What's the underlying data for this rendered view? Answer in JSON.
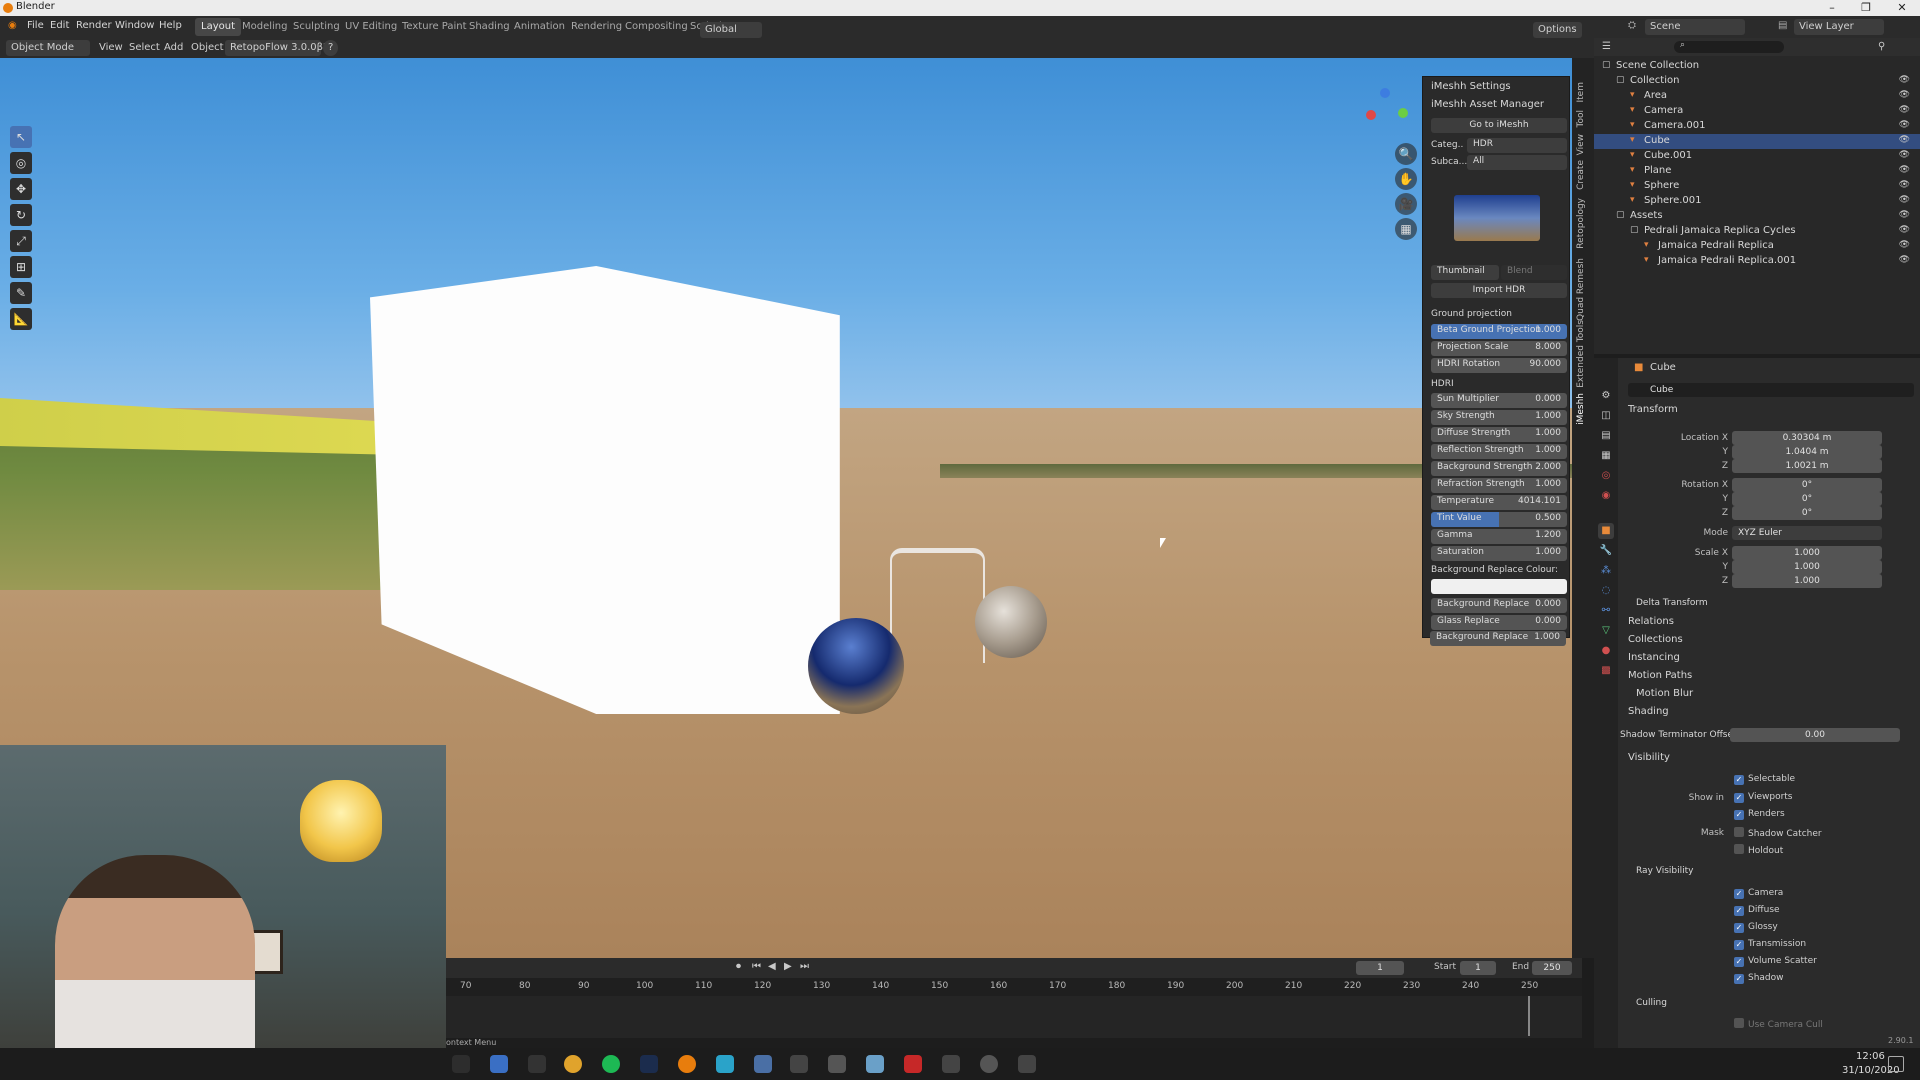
{
  "window": {
    "title": "Blender",
    "min": "–",
    "max": "❐",
    "close": "✕"
  },
  "menu": [
    "File",
    "Edit",
    "Render",
    "Window",
    "Help"
  ],
  "workspaces": [
    "Layout",
    "Modeling",
    "Sculpting",
    "UV Editing",
    "Texture Paint",
    "Shading",
    "Animation",
    "Rendering",
    "Compositing",
    "Scripting",
    "+"
  ],
  "header_right": {
    "scene": "Scene",
    "view_layer": "View Layer"
  },
  "viewport_header": {
    "mode": "Object Mode",
    "menus": [
      "View",
      "Select",
      "Add",
      "Object"
    ],
    "addon": "RetopoFlow 3.0.0β2",
    "help": "?",
    "transform": "Global",
    "options": "Options"
  },
  "tools": [
    "↖",
    "◎",
    "✥",
    "↻",
    "⤢",
    "⊞",
    "✎",
    "📐"
  ],
  "nav_buttons": [
    "🔍",
    "✋",
    "🎥",
    "▦"
  ],
  "colors": {
    "accent": "#4772b3",
    "sky": "#5a9fdf",
    "ground": "#b7936b"
  },
  "npanel": {
    "settings_title": "iMeshh Settings",
    "manager_title": "iMeshh Asset Manager",
    "goto": "Go to iMeshh",
    "categ_label": "Categ..",
    "categ_value": "HDR",
    "subca_label": "Subca...",
    "subca_value": "All",
    "thumbnail": "Thumbnail",
    "blend": "Blend",
    "import": "Import HDR",
    "ground_projection": "Ground projection",
    "gp_rows": [
      {
        "label": "Beta Ground Projection",
        "value": "1.000"
      },
      {
        "label": "Projection Scale",
        "value": "8.000"
      },
      {
        "label": "HDRI Rotation",
        "value": "90.000"
      }
    ],
    "hdri": "HDRI",
    "hdri_rows": [
      {
        "label": "Sun Multiplier",
        "value": "0.000"
      },
      {
        "label": "Sky Strength",
        "value": "1.000"
      },
      {
        "label": "Diffuse Strength",
        "value": "1.000"
      },
      {
        "label": "Reflection Strength",
        "value": "1.000"
      },
      {
        "label": "Background Strength",
        "value": "2.000"
      },
      {
        "label": "Refraction Strength",
        "value": "1.000"
      },
      {
        "label": "Temperature",
        "value": "4014.101"
      },
      {
        "label": "Tint Value",
        "value": "0.500"
      },
      {
        "label": "Gamma",
        "value": "1.200"
      },
      {
        "label": "Saturation",
        "value": "1.000"
      }
    ],
    "bg_replace_colour": "Background Replace Colour:",
    "bottom_rows": [
      {
        "label": "Background Replace",
        "value": "0.000"
      },
      {
        "label": "Glass Replace",
        "value": "0.000"
      },
      {
        "label": "Background Replace",
        "value": "1.000"
      }
    ],
    "vtabs": [
      "Item",
      "Tool",
      "View",
      "Create",
      "Retopology",
      "Quad Remesh",
      "Extended Tools",
      "iMeshh"
    ]
  },
  "outliner": {
    "rows": [
      {
        "name": "Scene Collection",
        "indent": 0
      },
      {
        "name": "Collection",
        "indent": 1
      },
      {
        "name": "Area",
        "indent": 2
      },
      {
        "name": "Camera",
        "indent": 2
      },
      {
        "name": "Camera.001",
        "indent": 2
      },
      {
        "name": "Cube",
        "indent": 2,
        "selected": true
      },
      {
        "name": "Cube.001",
        "indent": 2
      },
      {
        "name": "Plane",
        "indent": 2
      },
      {
        "name": "Sphere",
        "indent": 2
      },
      {
        "name": "Sphere.001",
        "indent": 2
      },
      {
        "name": "Assets",
        "indent": 1
      },
      {
        "name": "Pedrali Jamaica Replica Cycles",
        "indent": 2
      },
      {
        "name": "Jamaica Pedrali Replica",
        "indent": 3
      },
      {
        "name": "Jamaica Pedrali Replica.001",
        "indent": 3
      }
    ]
  },
  "properties": {
    "object_name": "Cube",
    "datablock": "Cube",
    "transform": "Transform",
    "location_label": "Location X",
    "location": [
      "0.30304 m",
      "1.0404 m",
      "1.0021 m"
    ],
    "rotation_label": "Rotation X",
    "rotation": [
      "0°",
      "0°",
      "0°"
    ],
    "mode_label": "Mode",
    "mode": "XYZ Euler",
    "scale_label": "Scale X",
    "scale": [
      "1.000",
      "1.000",
      "1.000"
    ],
    "y": "Y",
    "z": "Z",
    "sections": [
      "Delta Transform",
      "Relations",
      "Collections",
      "Instancing",
      "Motion Paths",
      "Motion Blur",
      "Shading"
    ],
    "shadow_term": "Shadow Terminator Offset",
    "shadow_term_value": "0.00",
    "visibility": "Visibility",
    "selectable": "Selectable",
    "show_in": "Show in",
    "viewports": "Viewports",
    "renders": "Renders",
    "mask": "Mask",
    "shadow_catcher": "Shadow Catcher",
    "holdout": "Holdout",
    "ray_visibility": "Ray Visibility",
    "rays": [
      "Camera",
      "Diffuse",
      "Glossy",
      "Transmission",
      "Volume Scatter",
      "Shadow"
    ],
    "culling": "Culling",
    "use_camera_cull": "Use Camera Cull",
    "version": "2.90.1"
  },
  "timeline": {
    "current": "1",
    "start_label": "Start",
    "start": "1",
    "end_label": "End",
    "end": "250",
    "ticks": [
      "70",
      "80",
      "90",
      "100",
      "110",
      "120",
      "130",
      "140",
      "150",
      "160",
      "170",
      "180",
      "190",
      "200",
      "210",
      "220",
      "230",
      "240",
      "250"
    ]
  },
  "status": {
    "text": "ontext Menu"
  },
  "taskbar": {
    "time": "12:06",
    "date": "31/10/2020"
  }
}
